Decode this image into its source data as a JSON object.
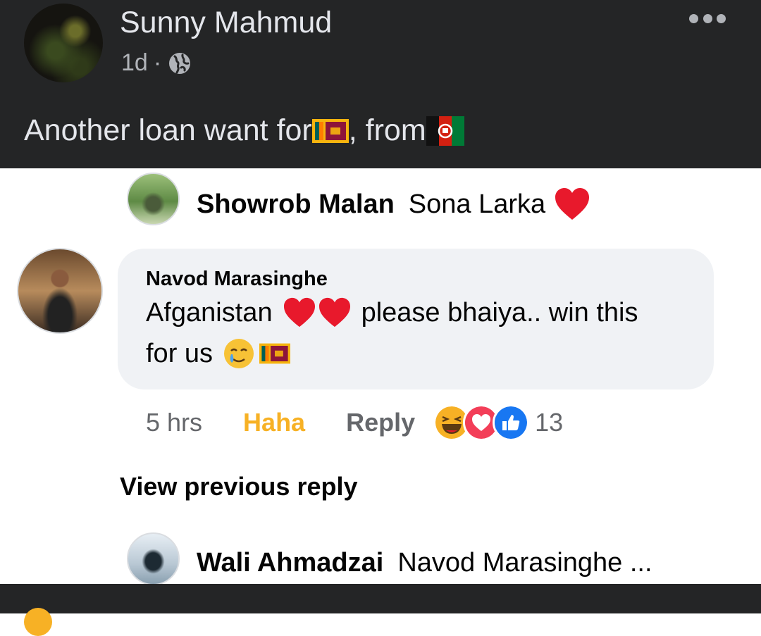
{
  "post": {
    "author": "Sunny Mahmud",
    "time": "1d",
    "separator": "·",
    "privacy_icon": "globe-icon",
    "text_part1": "Another loan want for ",
    "text_part2": ", from",
    "flags": [
      "sri-lanka-flag",
      "afghanistan-flag"
    ]
  },
  "comments": [
    {
      "author": "Showrob Malan",
      "text": "Sona Larka",
      "emoji": "red-heart"
    },
    {
      "author": "Navod Marasinghe",
      "line1_a": "Afganistan",
      "line1_b": "please bhaiya.. win this",
      "line2": "for us",
      "time": "5 hrs",
      "reaction_label": "Haha",
      "reply_label": "Reply",
      "reaction_icons": [
        "haha",
        "love",
        "like"
      ],
      "reaction_count": "13"
    }
  ],
  "view_previous": "View previous reply",
  "reply": {
    "author": "Wali Ahmadzai",
    "text": "Navod Marasinghe ..."
  },
  "colors": {
    "dark_bg": "#242526",
    "bubble": "#f0f2f5",
    "haha": "#f7b125",
    "love": "#f33e58",
    "like": "#1877f2"
  }
}
